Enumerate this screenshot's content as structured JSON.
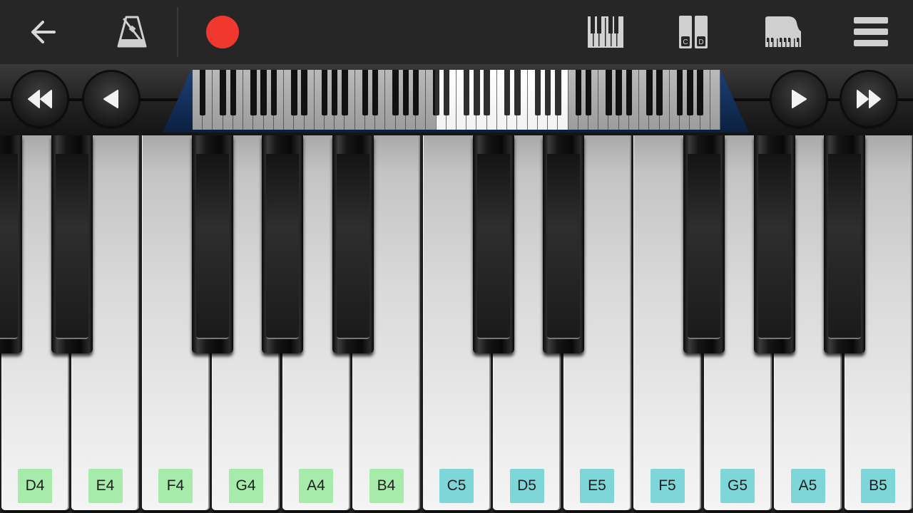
{
  "toolbar": {
    "icons": [
      "back-arrow-icon",
      "metronome-icon",
      "record-icon",
      "keyboard-icon",
      "two-row-cd-icon",
      "grand-piano-icon",
      "hamburger-menu-icon"
    ],
    "cd_label_c": "C",
    "cd_label_d": "D",
    "record_color": "#f0382f"
  },
  "navigator": {
    "icons": [
      "rewind-icon",
      "previous-icon",
      "next-icon",
      "fast-forward-icon"
    ]
  },
  "keyboard": {
    "white_keys": [
      {
        "label": "",
        "color": ""
      },
      {
        "label": "D4",
        "color": "#a6ebaa"
      },
      {
        "label": "E4",
        "color": "#a6ebaa"
      },
      {
        "label": "F4",
        "color": "#a6ebaa"
      },
      {
        "label": "G4",
        "color": "#a6ebaa"
      },
      {
        "label": "A4",
        "color": "#a6ebaa"
      },
      {
        "label": "B4",
        "color": "#a6ebaa"
      },
      {
        "label": "C5",
        "color": "#7ed6d8"
      },
      {
        "label": "D5",
        "color": "#7ed6d8"
      },
      {
        "label": "E5",
        "color": "#7ed6d8"
      },
      {
        "label": "F5",
        "color": "#7ed6d8"
      },
      {
        "label": "G5",
        "color": "#7ed6d8"
      },
      {
        "label": "A5",
        "color": "#7ed6d8"
      },
      {
        "label": "B5",
        "color": "#7ed6d8"
      }
    ]
  }
}
